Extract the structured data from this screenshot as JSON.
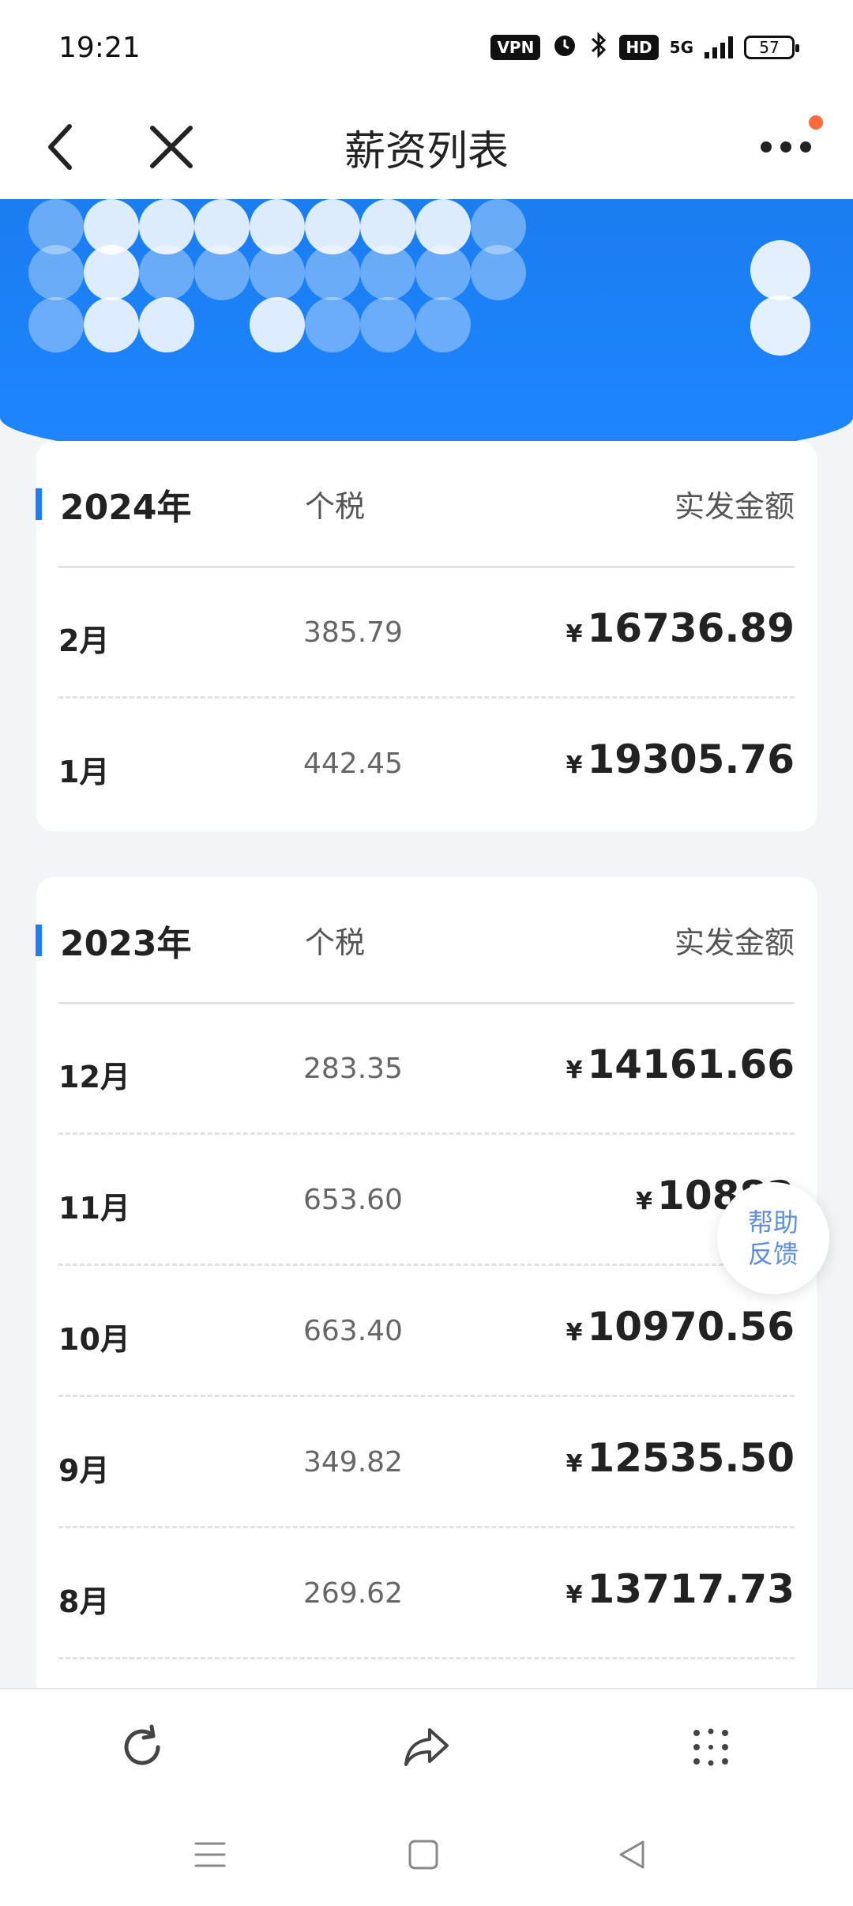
{
  "status_bar": {
    "time": "19:21",
    "vpn": "VPN",
    "hd": "HD",
    "network": "5G",
    "battery": "57",
    "icons": [
      "alarm-icon",
      "bluetooth-icon",
      "signal-icon"
    ]
  },
  "nav": {
    "title": "薪资列表",
    "icons": [
      "back-icon",
      "close-icon",
      "more-icon"
    ],
    "notify_color": "#ff6b3d"
  },
  "colors": {
    "primary": "#1f86ff",
    "accent": "#1f7ef5"
  },
  "sections": [
    {
      "year": "2024年",
      "tax_header": "个税",
      "net_header": "实发金额",
      "rows": [
        {
          "month": "2月",
          "tax": "385.79",
          "currency": "¥",
          "amount": "16736.89"
        },
        {
          "month": "1月",
          "tax": "442.45",
          "currency": "¥",
          "amount": "19305.76"
        }
      ]
    },
    {
      "year": "2023年",
      "tax_header": "个税",
      "net_header": "实发金额",
      "rows": [
        {
          "month": "12月",
          "tax": "283.35",
          "currency": "¥",
          "amount": "14161.66"
        },
        {
          "month": "11月",
          "tax": "653.60",
          "currency": "¥",
          "amount": "10882"
        },
        {
          "month": "10月",
          "tax": "663.40",
          "currency": "¥",
          "amount": "10970.56"
        },
        {
          "month": "9月",
          "tax": "349.82",
          "currency": "¥",
          "amount": "12535.50"
        },
        {
          "month": "8月",
          "tax": "269.62",
          "currency": "¥",
          "amount": "13717.73"
        }
      ]
    }
  ],
  "help": {
    "line1": "帮助",
    "line2": "反馈"
  },
  "toolbar": {
    "icons": [
      "refresh-icon",
      "share-icon",
      "apps-icon"
    ]
  },
  "system_nav": {
    "icons": [
      "recents-icon",
      "home-icon",
      "back-triangle-icon"
    ]
  }
}
